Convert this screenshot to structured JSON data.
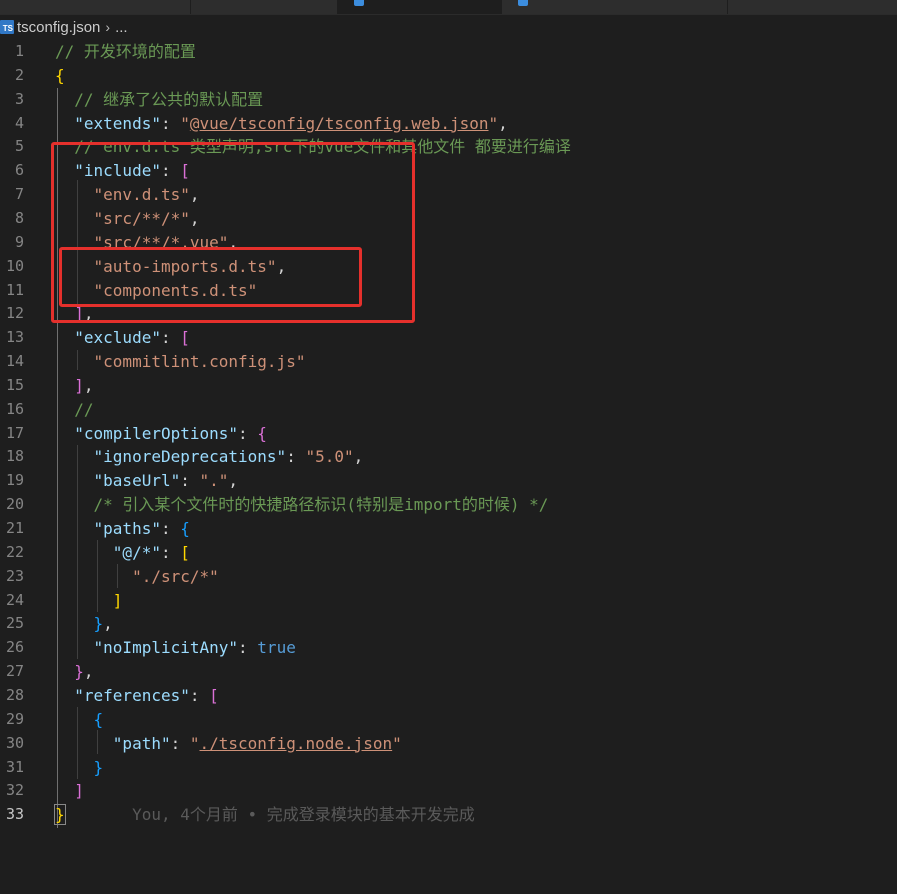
{
  "breadcrumb": {
    "file_icon": "TS",
    "file_name": "tsconfig.json",
    "chevron": "›",
    "ellipsis": "..."
  },
  "colors": {
    "comment": "#6a9955",
    "key": "#9cdcfe",
    "string": "#ce9178",
    "keyword": "#569cd6",
    "bracket_gold": "#ffd700",
    "bracket_purple": "#da70d6",
    "bracket_blue": "#179fff",
    "annotation_red": "#e5302c"
  },
  "lines": [
    {
      "n": "1",
      "tokens": [
        [
          "cmt",
          "// 开发环境的配置"
        ]
      ]
    },
    {
      "n": "2",
      "tokens": [
        [
          "b1",
          "{"
        ]
      ]
    },
    {
      "n": "3",
      "tokens": [
        [
          "cmt",
          "  // 继承了公共的默认配置"
        ]
      ]
    },
    {
      "n": "4",
      "tokens": [
        [
          "punc",
          "  "
        ],
        [
          "key",
          "\"extends\""
        ],
        [
          "punc",
          ": "
        ],
        [
          "str",
          "\""
        ],
        [
          "str link",
          "@vue/tsconfig/tsconfig.web.json"
        ],
        [
          "str",
          "\""
        ],
        [
          "punc",
          ","
        ]
      ]
    },
    {
      "n": "5",
      "tokens": [
        [
          "cmt",
          "  // env.d.ts 类型声明,src下的vue文件和其他文件 都要进行编译"
        ]
      ]
    },
    {
      "n": "6",
      "tokens": [
        [
          "punc",
          "  "
        ],
        [
          "key",
          "\"include\""
        ],
        [
          "punc",
          ": "
        ],
        [
          "b2",
          "["
        ]
      ]
    },
    {
      "n": "7",
      "tokens": [
        [
          "punc",
          "    "
        ],
        [
          "str",
          "\"env.d.ts\""
        ],
        [
          "punc",
          ","
        ]
      ]
    },
    {
      "n": "8",
      "tokens": [
        [
          "punc",
          "    "
        ],
        [
          "str",
          "\"src/**/*\""
        ],
        [
          "punc",
          ","
        ]
      ]
    },
    {
      "n": "9",
      "tokens": [
        [
          "punc",
          "    "
        ],
        [
          "str",
          "\"src/**/*.vue\""
        ],
        [
          "punc",
          ","
        ]
      ]
    },
    {
      "n": "10",
      "tokens": [
        [
          "punc",
          "    "
        ],
        [
          "str",
          "\"auto-imports.d.ts\""
        ],
        [
          "punc",
          ","
        ]
      ]
    },
    {
      "n": "11",
      "tokens": [
        [
          "punc",
          "    "
        ],
        [
          "str",
          "\"components.d.ts\""
        ]
      ]
    },
    {
      "n": "12",
      "tokens": [
        [
          "punc",
          "  "
        ],
        [
          "b2",
          "]"
        ],
        [
          "punc",
          ","
        ]
      ]
    },
    {
      "n": "13",
      "tokens": [
        [
          "punc",
          "  "
        ],
        [
          "key",
          "\"exclude\""
        ],
        [
          "punc",
          ": "
        ],
        [
          "b2",
          "["
        ]
      ]
    },
    {
      "n": "14",
      "tokens": [
        [
          "punc",
          "    "
        ],
        [
          "str",
          "\"commitlint.config.js\""
        ]
      ]
    },
    {
      "n": "15",
      "tokens": [
        [
          "punc",
          "  "
        ],
        [
          "b2",
          "]"
        ],
        [
          "punc",
          ","
        ]
      ]
    },
    {
      "n": "16",
      "tokens": [
        [
          "cmt",
          "  //"
        ]
      ]
    },
    {
      "n": "17",
      "tokens": [
        [
          "punc",
          "  "
        ],
        [
          "key",
          "\"compilerOptions\""
        ],
        [
          "punc",
          ": "
        ],
        [
          "b2",
          "{"
        ]
      ]
    },
    {
      "n": "18",
      "tokens": [
        [
          "punc",
          "    "
        ],
        [
          "key",
          "\"ignoreDeprecations\""
        ],
        [
          "punc",
          ": "
        ],
        [
          "str",
          "\"5.0\""
        ],
        [
          "punc",
          ","
        ]
      ]
    },
    {
      "n": "19",
      "tokens": [
        [
          "punc",
          "    "
        ],
        [
          "key",
          "\"baseUrl\""
        ],
        [
          "punc",
          ": "
        ],
        [
          "str",
          "\".\""
        ],
        [
          "punc",
          ","
        ]
      ]
    },
    {
      "n": "20",
      "tokens": [
        [
          "cmt",
          "    /* 引入某个文件时的快捷路径标识(特别是import的时候) */"
        ]
      ]
    },
    {
      "n": "21",
      "tokens": [
        [
          "punc",
          "    "
        ],
        [
          "key",
          "\"paths\""
        ],
        [
          "punc",
          ": "
        ],
        [
          "b3",
          "{"
        ]
      ]
    },
    {
      "n": "22",
      "tokens": [
        [
          "punc",
          "      "
        ],
        [
          "key",
          "\"@/*\""
        ],
        [
          "punc",
          ": "
        ],
        [
          "b1",
          "["
        ]
      ]
    },
    {
      "n": "23",
      "tokens": [
        [
          "punc",
          "        "
        ],
        [
          "str",
          "\"./src/*\""
        ]
      ]
    },
    {
      "n": "24",
      "tokens": [
        [
          "punc",
          "      "
        ],
        [
          "b1",
          "]"
        ]
      ]
    },
    {
      "n": "25",
      "tokens": [
        [
          "punc",
          "    "
        ],
        [
          "b3",
          "}"
        ],
        [
          "punc",
          ","
        ]
      ]
    },
    {
      "n": "26",
      "tokens": [
        [
          "punc",
          "    "
        ],
        [
          "key",
          "\"noImplicitAny\""
        ],
        [
          "punc",
          ": "
        ],
        [
          "kw",
          "true"
        ]
      ]
    },
    {
      "n": "27",
      "tokens": [
        [
          "punc",
          "  "
        ],
        [
          "b2",
          "}"
        ],
        [
          "punc",
          ","
        ]
      ]
    },
    {
      "n": "28",
      "tokens": [
        [
          "punc",
          "  "
        ],
        [
          "key",
          "\"references\""
        ],
        [
          "punc",
          ": "
        ],
        [
          "b2",
          "["
        ]
      ]
    },
    {
      "n": "29",
      "tokens": [
        [
          "punc",
          "    "
        ],
        [
          "b3",
          "{"
        ]
      ]
    },
    {
      "n": "30",
      "tokens": [
        [
          "punc",
          "      "
        ],
        [
          "key",
          "\"path\""
        ],
        [
          "punc",
          ": "
        ],
        [
          "str",
          "\""
        ],
        [
          "str link",
          "./tsconfig.node.json"
        ],
        [
          "str",
          "\""
        ]
      ]
    },
    {
      "n": "31",
      "tokens": [
        [
          "punc",
          "    "
        ],
        [
          "b3",
          "}"
        ]
      ]
    },
    {
      "n": "32",
      "tokens": [
        [
          "punc",
          "  "
        ],
        [
          "b2",
          "]"
        ]
      ]
    },
    {
      "n": "33",
      "tokens": [
        [
          "b1 curbracket",
          "}"
        ],
        [
          "blame",
          "       You, 4个月前 • 完成登录模块的基本开发完成"
        ]
      ]
    }
  ],
  "current_line": "33"
}
